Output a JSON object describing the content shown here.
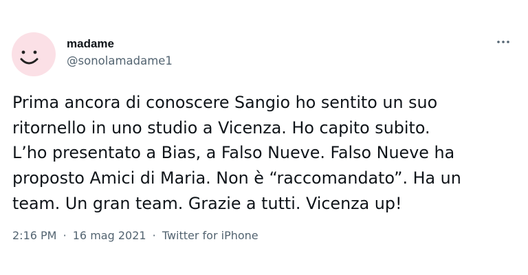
{
  "author": {
    "display_name": "madame",
    "handle": "@sonolamadame1",
    "avatar_icon": "smiley-face-icon",
    "avatar_color": "#fbe0e6"
  },
  "more_icon": "more-dots-icon",
  "tweet": {
    "text": "Prima ancora di conoscere Sangio ho sentito un suo\nritornello in uno studio a Vicenza. Ho capito subito.\nL’ho presentato a Bias, a Falso Nueve. Falso Nueve ha\nproposto Amici di Maria. Non è “raccomandato”. Ha un\nteam. Un gran team. Grazie a tutti. Vicenza up!"
  },
  "meta": {
    "time": "2:16 PM",
    "separator": "·",
    "date": "16 mag 2021",
    "source": "Twitter for iPhone"
  },
  "colors": {
    "text": "#0f1419",
    "secondary": "#536471"
  }
}
